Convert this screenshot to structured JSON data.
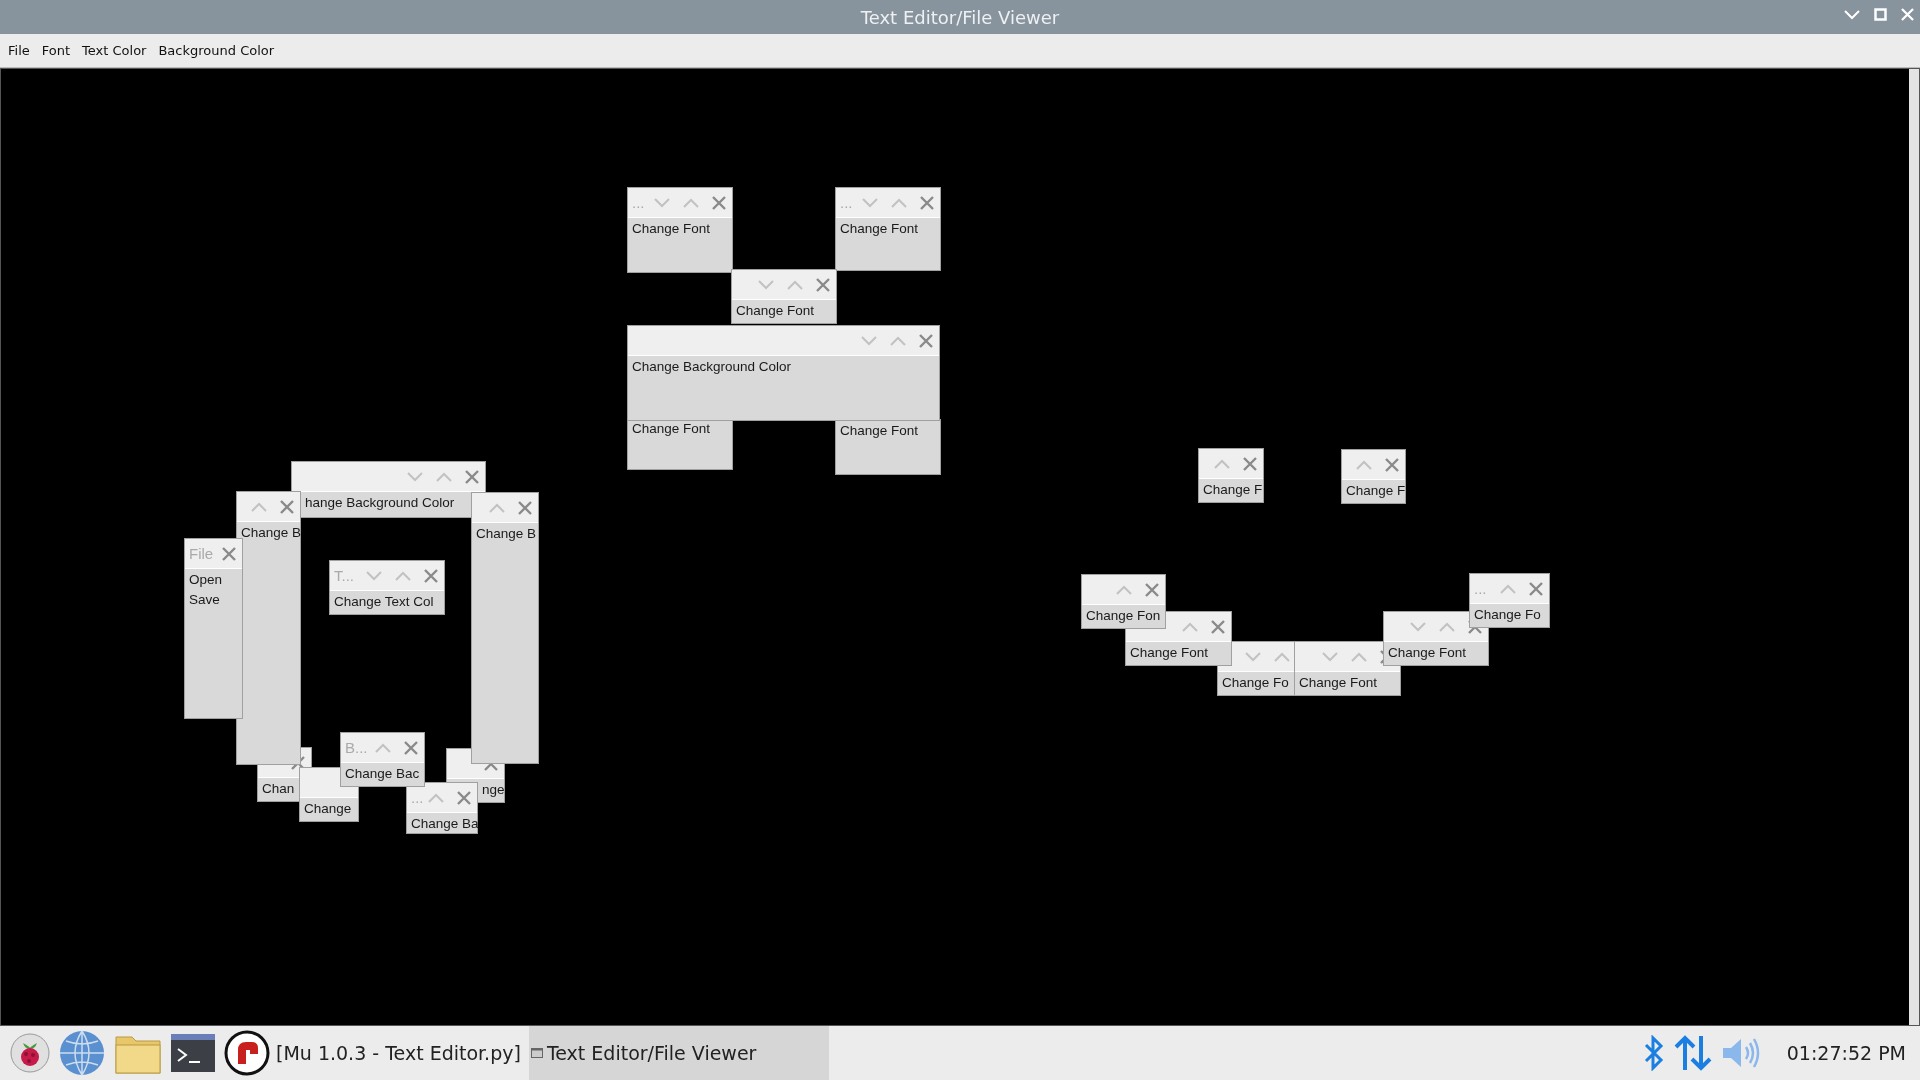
{
  "window": {
    "title": "Text Editor/File Viewer"
  },
  "menu_bar": [
    "File",
    "Font",
    "Text Color",
    "Background Color"
  ],
  "tearoff_menus": [
    {
      "title": "...",
      "items": [
        "Change Font"
      ]
    },
    {
      "title": "...",
      "items": [
        "Change Font"
      ]
    },
    {
      "items": [
        "Change Font"
      ]
    },
    {
      "items": [
        "Change Background Color"
      ]
    },
    {
      "items": [
        "Change Font"
      ]
    },
    {
      "items": [
        "Change Font"
      ]
    },
    {
      "items": [
        "hange Background Color"
      ]
    },
    {
      "items": [
        "Change B"
      ]
    },
    {
      "items": [
        "Change B"
      ]
    },
    {
      "title": "File",
      "items": [
        "Open",
        "Save"
      ]
    },
    {
      "title": "T...",
      "items": [
        "Change Text Col"
      ]
    },
    {
      "title": "B...",
      "items": [
        "Change Bac"
      ]
    },
    {
      "items": [
        "Chan"
      ]
    },
    {
      "items": [
        "nge"
      ]
    },
    {
      "items": [
        "Change"
      ]
    },
    {
      "title": "...",
      "items": [
        "Change Ba"
      ]
    },
    {
      "items": [
        "Change F"
      ]
    },
    {
      "items": [
        "Change F"
      ]
    },
    {
      "items": [
        "Change Fon"
      ]
    },
    {
      "title": "...",
      "items": [
        "Change Fo"
      ]
    },
    {
      "items": [
        "Change Font"
      ]
    },
    {
      "items": [
        "Change Font"
      ]
    },
    {
      "items": [
        "Change Fo"
      ]
    },
    {
      "items": [
        "Change Font"
      ]
    }
  ],
  "taskbar": {
    "tasks": [
      {
        "label": "[Mu 1.0.3 - Text Editor.py]",
        "selected": false
      },
      {
        "label": "Text Editor/File Viewer",
        "selected": true
      }
    ],
    "clock": "01:27:52 PM"
  }
}
